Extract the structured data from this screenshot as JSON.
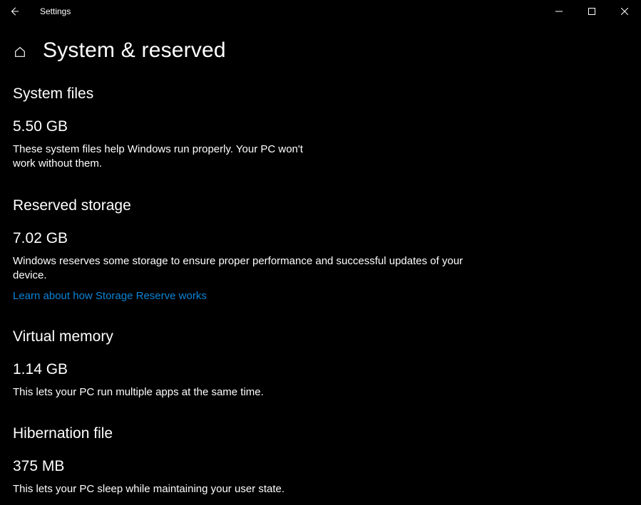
{
  "window": {
    "app_title": "Settings"
  },
  "header": {
    "title": "System & reserved"
  },
  "sections": {
    "system_files": {
      "heading": "System files",
      "size": "5.50 GB",
      "description": "These system files help Windows run properly. Your PC won't work without them."
    },
    "reserved_storage": {
      "heading": "Reserved storage",
      "size": "7.02 GB",
      "description": "Windows reserves some storage to ensure proper performance and successful updates of your device.",
      "link": "Learn about how Storage Reserve works"
    },
    "virtual_memory": {
      "heading": "Virtual memory",
      "size": "1.14 GB",
      "description": "This lets your PC run multiple apps at the same time."
    },
    "hibernation_file": {
      "heading": "Hibernation file",
      "size": "375 MB",
      "description": "This lets your PC sleep while maintaining your user state."
    }
  }
}
